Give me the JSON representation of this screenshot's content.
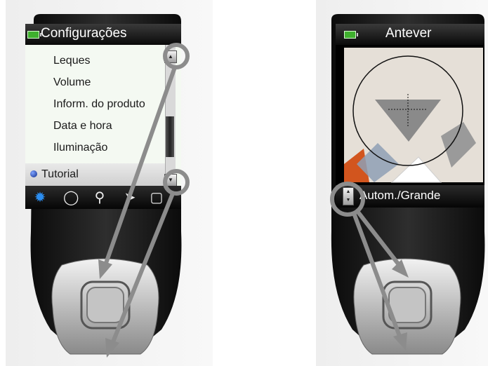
{
  "left_screen": {
    "title": "Configurações",
    "menu_items": [
      {
        "label": "Leques"
      },
      {
        "label": "Volume"
      },
      {
        "label": "Inform. do produto"
      },
      {
        "label": "Data e hora"
      },
      {
        "label": "Iluminação"
      },
      {
        "label": "Tutorial",
        "selected": true
      }
    ],
    "toolbar_icons": [
      "gear-icon",
      "circle-icon",
      "magnifier-icon",
      "arrow-icon",
      "folder-icon"
    ]
  },
  "right_screen": {
    "title": "Antever",
    "status_label": "Autom./Grande"
  },
  "colors": {
    "device_body": "#1c1c1c",
    "accent_battery": "#3fb02e",
    "annotation_gray": "#8c8c8c",
    "gear_blue": "#2b8df0"
  }
}
